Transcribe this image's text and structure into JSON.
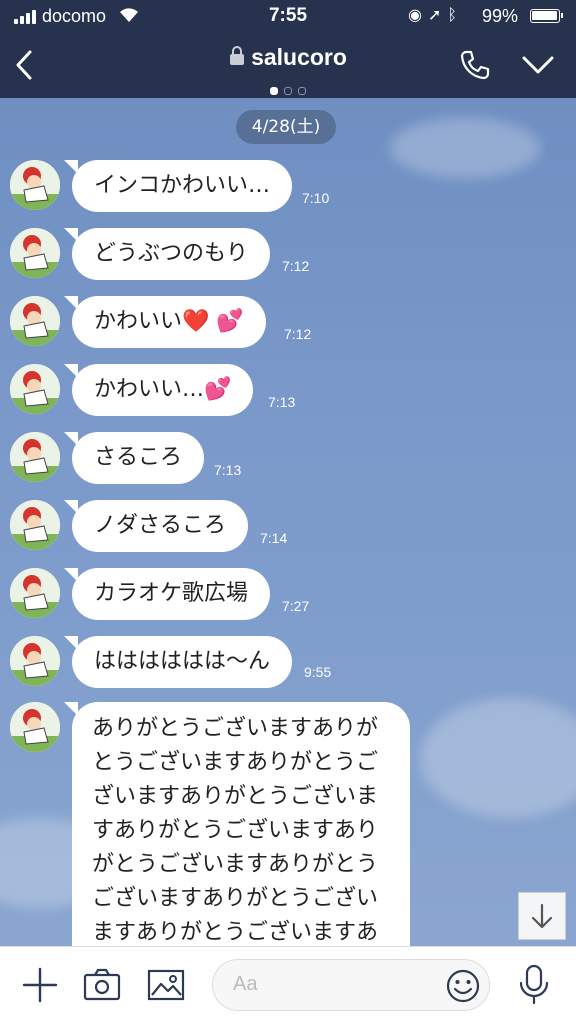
{
  "status_bar": {
    "carrier": "docomo",
    "time": "7:55",
    "battery": "99%"
  },
  "header": {
    "title": "salucoro",
    "page_count": 3,
    "page_active": 0
  },
  "chat": {
    "date_label": "4/28(土)",
    "messages": [
      {
        "text": "インコかわいい…",
        "time": "7:10"
      },
      {
        "text": "どうぶつのもり",
        "time": "7:12"
      },
      {
        "text": "かわいい❤️ 💕",
        "time": "7:12"
      },
      {
        "text": "かわいい…💕",
        "time": "7:13"
      },
      {
        "text": "さるころ",
        "time": "7:13"
      },
      {
        "text": "ノダさるころ",
        "time": "7:14"
      },
      {
        "text": "カラオケ歌広場",
        "time": "7:27"
      },
      {
        "text": "はははははは〜ん",
        "time": "9:55"
      },
      {
        "text": "ありがとうございますありがとうございますありがとうございますありがとうございますありがとうございますありがとうございますありがとうございますありがとうございますありがとうございますありがとうございますありがと"
      }
    ]
  },
  "input": {
    "placeholder": "Aa"
  },
  "colors": {
    "header_bg": "#27334e",
    "chat_bg": "#7a98c9",
    "bubble": "#ffffff"
  }
}
